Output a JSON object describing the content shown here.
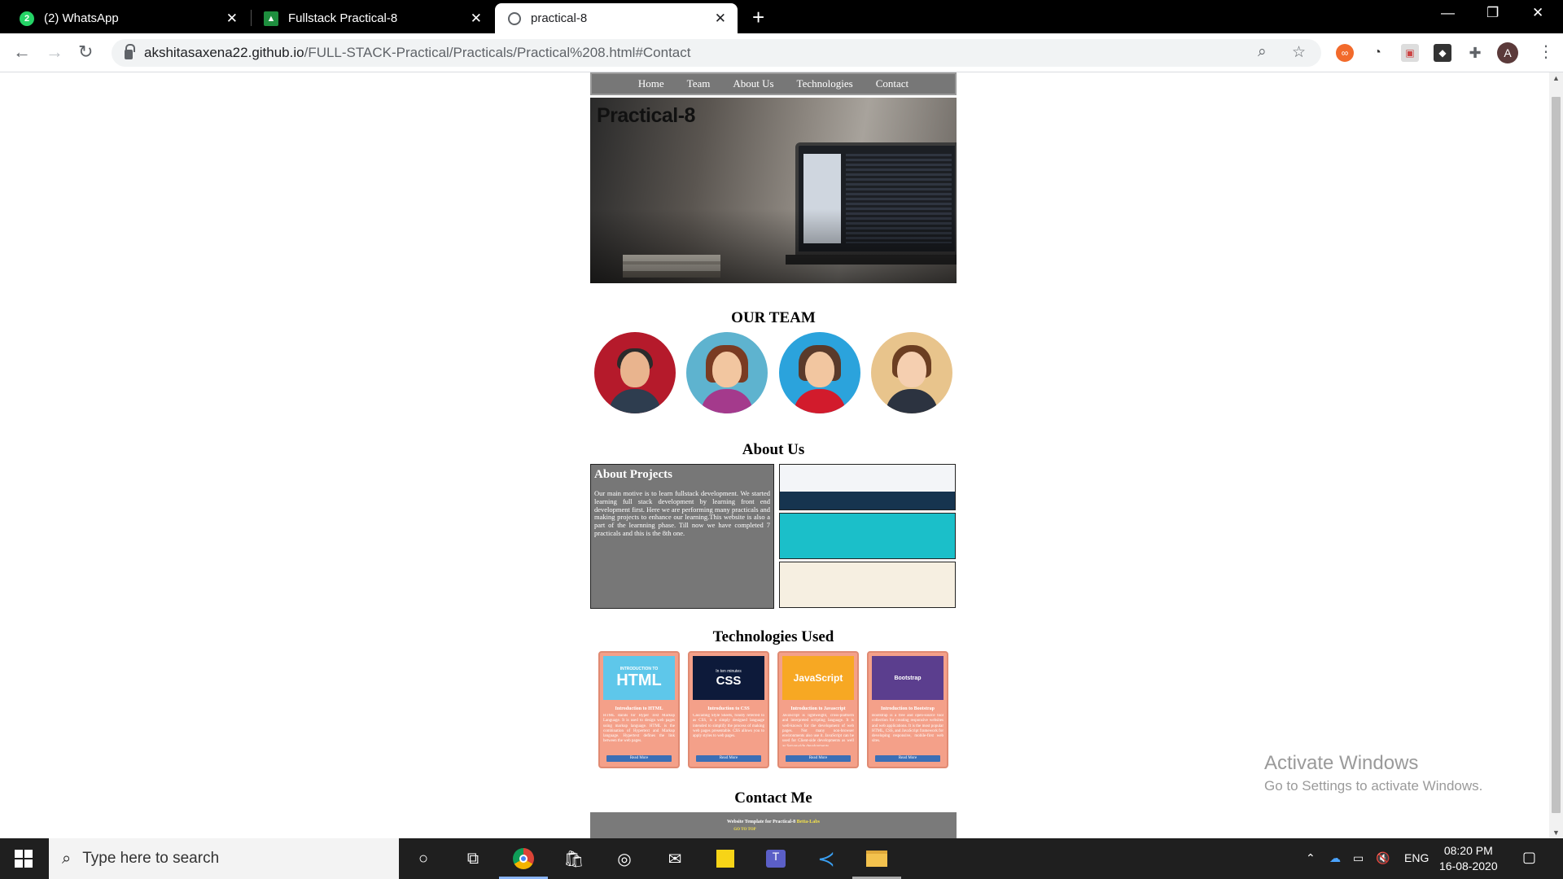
{
  "browser": {
    "tabs": [
      {
        "label": "(2) WhatsApp",
        "icon": "whatsapp-icon",
        "badge": "2"
      },
      {
        "label": "Fullstack Practical-8",
        "icon": "classroom-icon"
      },
      {
        "label": "practical-8",
        "icon": "globe-icon"
      }
    ],
    "url_host": "akshitasaxena22.github.io",
    "url_path": "/FULL-STACK-Practical/Practicals/Practical%208.html#Contact",
    "avatar_letter": "A"
  },
  "site": {
    "nav": [
      "Home",
      "Team",
      "About Us",
      "Technologies",
      "Contact"
    ],
    "hero_title": "Practical-8",
    "team_title": "OUR TEAM",
    "about_title": "About Us",
    "about_box_title": "About Projects",
    "about_box_text": "Our main motive is to learn fullstack development. We started learning full stack development by learning front end development first. Here we are performing many practicals and making projects to enhance our learning.This website is also a part of the learnning phase. Till now we have completed 7 practicals and this is the 8th one.",
    "tech_title": "Technologies Used",
    "tech_cards": [
      {
        "img_label": "HTML",
        "img_sub": "INTRODUCTION TO",
        "name": "Introduction to HTML",
        "text": "HTML stands for Hyper Text Markup Language. It is used to design web pages using markup language. HTML is the combination of Hypertext and Markup language. Hypertext defines the link between the web pages.",
        "button": "Read More"
      },
      {
        "img_label": "CSS",
        "img_sub": "In ten minutes",
        "name": "Introduction to CSS",
        "text": "Cascading Style Sheets, fondly referred to as CSS, is a simply designed language intended to simplify the process of making web pages presentable. CSS allows you to apply styles to web pages.",
        "button": "Read More"
      },
      {
        "img_label": "JavaScript",
        "img_sub": "",
        "name": "Introduction to Javascript",
        "text": "JavaScript is lightweight, cross-platform and interpreted scripting language. It is well-known for the development of web pages. Not many non-browser environments also use it. JavaScript can be used for Client-side developments as well as Server-side developments.",
        "button": "Read More"
      },
      {
        "img_label": "Bootstrap",
        "img_sub": "",
        "name": "Introduction to Bootstrap",
        "text": "Bootstrap is a free and open-source tool collection for creating responsive websites and web applications. It is the most popular HTML, CSS, and JavaScript framework for developing responsive, mobile-first web sites.",
        "button": "Read More"
      }
    ],
    "contact_title": "Contact Me",
    "footer_prefix": "Website Template for Practical-8",
    "footer_brand": "Betta-Labs",
    "footer_link": "GO TO TOP"
  },
  "watermark": {
    "title": "Activate Windows",
    "subtitle": "Go to Settings to activate Windows."
  },
  "taskbar": {
    "search_placeholder": "Type here to search",
    "lang": "ENG",
    "time": "08:20 PM",
    "date": "16-08-2020"
  },
  "colors": {
    "nav_bg": "#777777",
    "tech_card_bg": "#f4a089",
    "footer_bg": "#7a7a7a",
    "footer_highlight": "#f5e34a",
    "taskbar_bg": "#1f1f1f"
  }
}
